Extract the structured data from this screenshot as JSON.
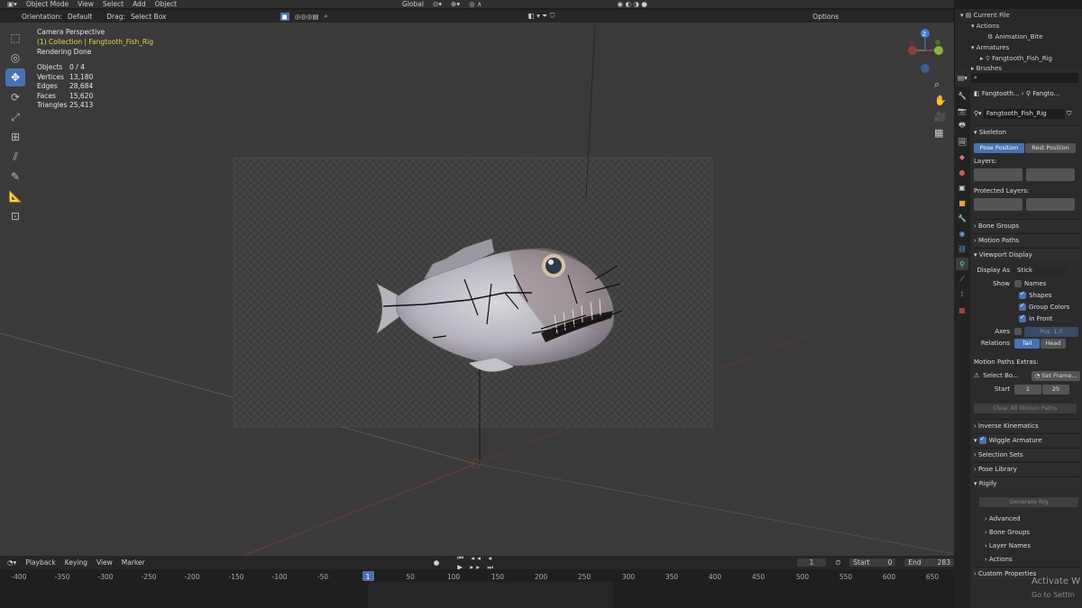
{
  "header": {
    "mode": "Object Mode",
    "menus": [
      "View",
      "Select",
      "Add",
      "Object"
    ],
    "transform_orientation": "Global",
    "options_label": "Options"
  },
  "tool_header": {
    "orientation_label": "Orientation:",
    "orientation_value": "Default",
    "drag_label": "Drag:",
    "drag_value": "Select Box"
  },
  "viewport": {
    "view_name": "Camera Perspective",
    "collection": "(1) Collection | Fangtooth_Fish_Rig",
    "render_status": "Rendering Done",
    "stats": [
      {
        "label": "Objects",
        "value": "0 / 4"
      },
      {
        "label": "Vertices",
        "value": "13,180"
      },
      {
        "label": "Edges",
        "value": "28,684"
      },
      {
        "label": "Faces",
        "value": "15,620"
      },
      {
        "label": "Triangles",
        "value": "25,413"
      }
    ],
    "gizmo": {
      "z": "Z",
      "y": "Y",
      "x": "X"
    },
    "colors": {
      "x_axis": "#d04a4a",
      "y_axis": "#8bb43a",
      "z_axis": "#3f7fd6"
    }
  },
  "timeline": {
    "menus": [
      "Playback",
      "Keying",
      "View",
      "Marker"
    ],
    "current_frame": "1",
    "start_label": "Start",
    "start_value": "0",
    "end_label": "End",
    "end_value": "283",
    "ticks": [
      "-400",
      "-350",
      "-300",
      "-250",
      "-200",
      "-150",
      "-100",
      "-50",
      "1",
      "50",
      "100",
      "150",
      "200",
      "250",
      "300",
      "350",
      "400",
      "450",
      "500",
      "550",
      "600",
      "650"
    ]
  },
  "outliner": {
    "items": [
      "Current File",
      "Actions",
      "Animation_Bite",
      "Armatures",
      "Fangtooth_Fish_Rig",
      "Brushes"
    ]
  },
  "properties": {
    "breadcrumb": [
      "Fangtooth...",
      "Fangto..."
    ],
    "data_name": "Fangtooth_Fish_Rig",
    "skeleton_title": "Skeleton",
    "pose_position": "Pose Position",
    "rest_position": "Rest Position",
    "layers_label": "Layers:",
    "protected_layers_label": "Protected Layers:",
    "bone_groups": "Bone Groups",
    "motion_paths": "Motion Paths",
    "viewport_display": "Viewport Display",
    "display_as_label": "Display As",
    "display_as_value": "Stick",
    "show_label": "Show",
    "names": "Names",
    "shapes": "Shapes",
    "group_colors": "Group Colors",
    "in_front": "In Front",
    "axes_label": "Axes",
    "axes_pos": "Pos",
    "axes_value": "1.0",
    "relations_label": "Relations",
    "tail": "Tail",
    "head": "Head",
    "motion_paths_extras": "Motion Paths Extras:",
    "select_bones": "Select Bo...",
    "set_frames": "Set Frame...",
    "start_label": "Start",
    "start_value": "1",
    "end_value": "25",
    "clear_motion_paths": "Clear All Motion Paths",
    "inverse_kinematics": "Inverse Kinematics",
    "wiggle_armature": "Wiggle Armature",
    "selection_sets": "Selection Sets",
    "pose_library": "Pose Library",
    "rigify": "Rigify",
    "generate_rig": "Generate Rig",
    "advanced": "Advanced",
    "rigify_bone_groups": "Bone Groups",
    "layer_names": "Layer Names",
    "actions": "Actions",
    "custom_properties": "Custom Properties"
  },
  "watermark": {
    "line1": "Activate W",
    "line2": "Go to Settin"
  }
}
